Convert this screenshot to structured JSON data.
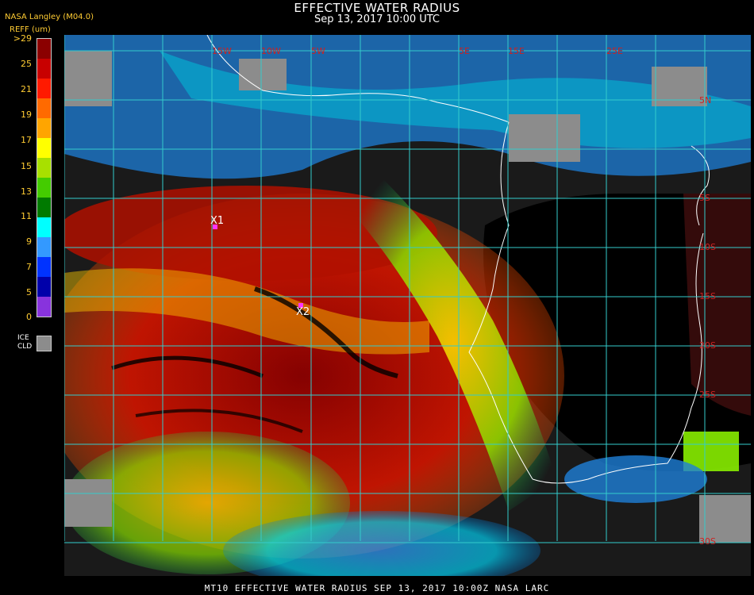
{
  "header": {
    "title": "EFFECTIVE WATER RADIUS",
    "subtitle": "Sep 13, 2017 10:00 UTC",
    "product": "NASA Langley (M04.0)"
  },
  "legend": {
    "label": "REFF (um)",
    "ticks": [
      ">29",
      "25",
      "21",
      "19",
      "17",
      "15",
      "13",
      "11",
      "9",
      "7",
      "5",
      "0"
    ],
    "colors": [
      "#8b0000",
      "#c80000",
      "#ff1a00",
      "#ff6a00",
      "#ffa500",
      "#ffff00",
      "#a8e000",
      "#44cc00",
      "#007a00",
      "#00ffff",
      "#3399ff",
      "#0033ff",
      "#0000aa",
      "#8833dd"
    ],
    "ice_label_line1": "ICE",
    "ice_label_line2": "CLD",
    "ice_color": "#8c8c8c"
  },
  "map": {
    "grid_color": "#33cccc",
    "lon_labels": [
      "15W",
      "10W",
      "5W",
      "5E",
      "15E",
      "25E"
    ],
    "lat_labels": [
      "5N",
      "5S",
      "10S",
      "15S",
      "20S",
      "25S",
      "30S"
    ],
    "markers": [
      {
        "label": "X1",
        "color": "#ff33ff"
      },
      {
        "label": "X2",
        "color": "#ff33ff"
      }
    ]
  },
  "footer": {
    "text": "MT10  EFFECTIVE WATER RADIUS  SEP 13, 2017 10:00Z  NASA LARC"
  }
}
